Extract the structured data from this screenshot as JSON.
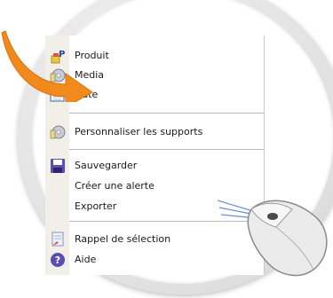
{
  "menu": {
    "items": [
      {
        "label": "Produit",
        "icon": "product-icon"
      },
      {
        "label": "Media",
        "icon": "media-icon"
      },
      {
        "label": "Date",
        "icon": "calendar-icon"
      },
      {
        "label": "Personnaliser les supports",
        "icon": "customize-icon"
      },
      {
        "label": "Sauvegarder",
        "icon": "save-icon"
      },
      {
        "label": "Créer une alerte",
        "icon": ""
      },
      {
        "label": "Exporter",
        "icon": ""
      },
      {
        "label": "Rappel de sélection",
        "icon": "recall-selection-icon"
      },
      {
        "label": "Aide",
        "icon": "help-icon"
      }
    ]
  },
  "decor": {
    "arrow_color": "#f08a1c",
    "mouse": "computer-mouse-icon"
  }
}
